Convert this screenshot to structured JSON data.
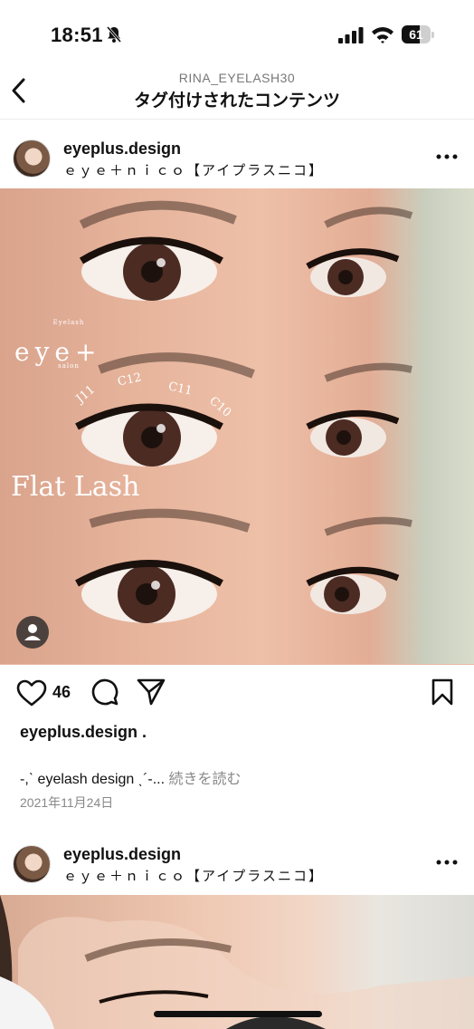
{
  "status_bar": {
    "time": "18:51",
    "battery": "61",
    "battery_level": 0.61
  },
  "nav": {
    "subtitle": "RINA_EYELASH30",
    "title": "タグ付けされたコンテンツ"
  },
  "post1": {
    "username": "eyeplus.design",
    "subtitle": "ｅｙｅ＋ｎｉｃｏ【アイプラスニコ】",
    "overlay": {
      "eyelash": "Eyelash",
      "brand": "eye+",
      "salon": "salon",
      "flat": "Flat Lash",
      "curls": [
        "J11",
        "C12",
        "C11",
        "C10"
      ]
    },
    "like_count": "46",
    "caption_user": "eyeplus.design .",
    "caption_text": "-,ˋ eyelash design ˎ´-... ",
    "caption_more": "続きを読む",
    "date": "2021年11月24日"
  },
  "post2": {
    "username": "eyeplus.design",
    "subtitle": "ｅｙｅ＋ｎｉｃｏ【アイプラスニコ】"
  },
  "icons": [
    "bell-slash-icon",
    "signal-icon",
    "wifi-icon",
    "battery-icon",
    "back-chevron-icon",
    "more-dots-icon",
    "heart-icon",
    "comment-icon",
    "share-icon",
    "bookmark-icon",
    "user-tag-icon"
  ]
}
